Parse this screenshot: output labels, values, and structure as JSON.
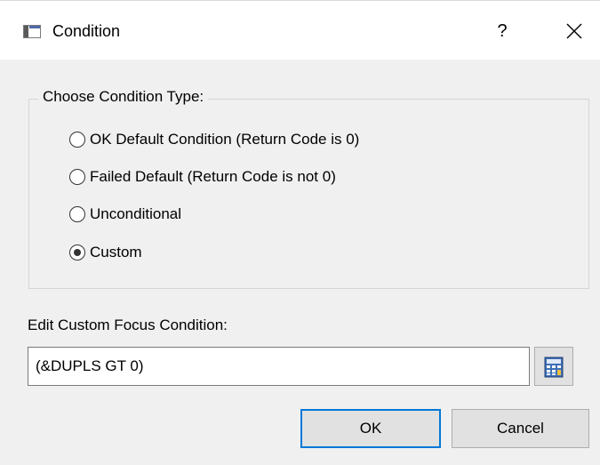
{
  "window": {
    "title": "Condition",
    "help_label": "?"
  },
  "condition_group": {
    "legend": "Choose Condition Type:",
    "options": [
      {
        "label": "OK Default Condition (Return Code is 0)",
        "selected": false
      },
      {
        "label": "Failed Default (Return Code is not 0)",
        "selected": false
      },
      {
        "label": "Unconditional",
        "selected": false
      },
      {
        "label": "Custom",
        "selected": true
      }
    ]
  },
  "custom_condition": {
    "label": "Edit Custom Focus Condition:",
    "value": "(&DUPLS GT 0)"
  },
  "buttons": {
    "ok_label": "OK",
    "cancel_label": "Cancel"
  },
  "colors": {
    "dialog_background": "#f0f0f0",
    "titlebar_background": "#ffffff",
    "default_button_border": "#0078d7",
    "button_background": "#e1e1e1"
  },
  "icons": {
    "app": "window-icon",
    "close": "close-icon",
    "calculator": "calculator-icon"
  }
}
